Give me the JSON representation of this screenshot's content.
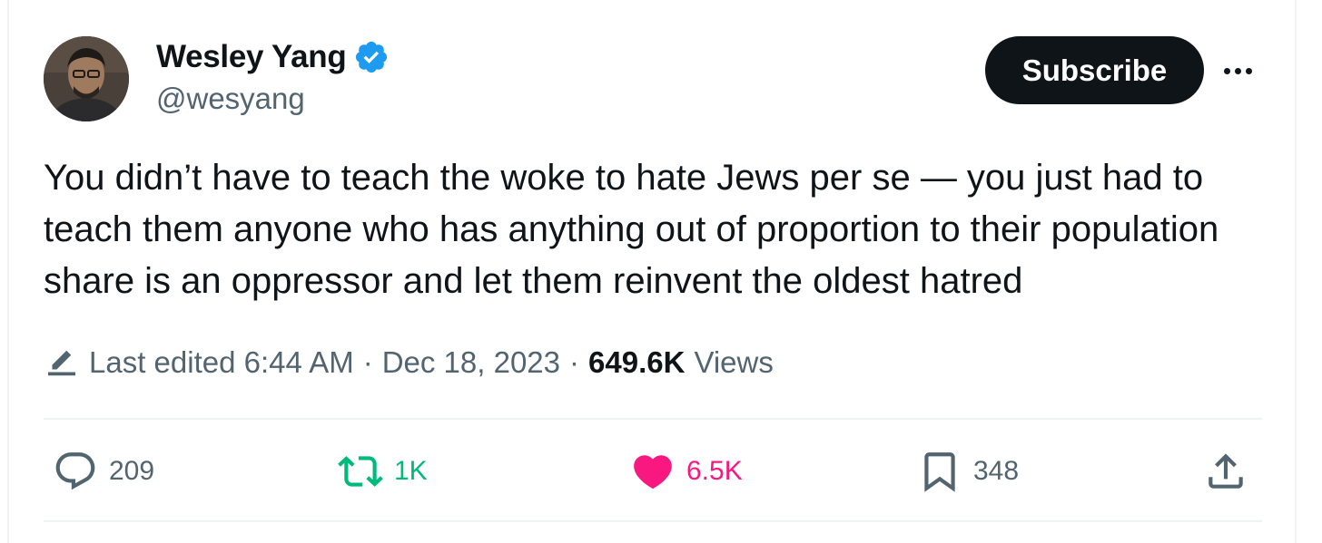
{
  "author": {
    "display_name": "Wesley Yang",
    "handle": "@wesyang",
    "verified": true,
    "avatar_icon": "user-avatar"
  },
  "header": {
    "subscribe_label": "Subscribe",
    "more_icon": "more-options-icon"
  },
  "tweet": {
    "text": "You didn’t have to teach the woke to hate Jews per se — you just had to teach them anyone who has anything out of proportion to their population share is an oppressor and let them reinvent the oldest hatred"
  },
  "meta": {
    "edited_label": "Last edited 6:44 AM",
    "separator": "·",
    "date": "Dec 18, 2023",
    "views_count": "649.6K",
    "views_label": "Views"
  },
  "actions": {
    "replies": "209",
    "reposts": "1K",
    "likes": "6.5K",
    "bookmarks": "348"
  },
  "colors": {
    "text_primary": "#0f1419",
    "text_secondary": "#536471",
    "verified_blue": "#1d9bf0",
    "repost_green": "#00ba7c",
    "like_pink": "#f91880",
    "divider": "#eff3f4"
  }
}
